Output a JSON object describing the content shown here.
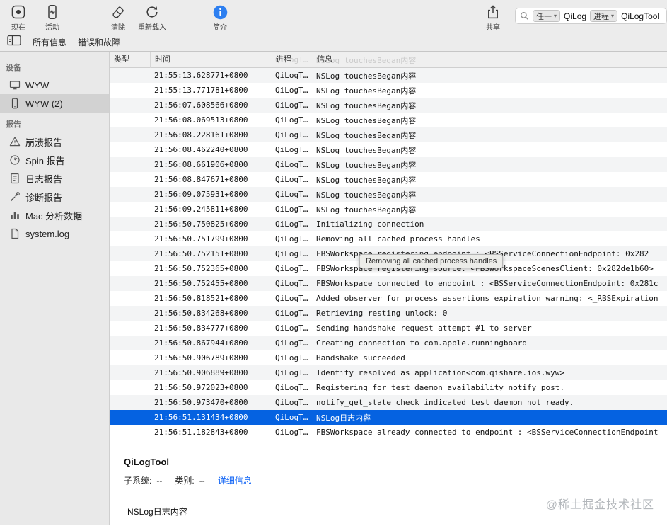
{
  "toolbar": {
    "now_label": "现在",
    "activity_label": "活动",
    "clear_label": "清除",
    "reload_label": "重新载入",
    "info_label": "简介",
    "share_label": "共享",
    "search_tokens": [
      {
        "type": "任一",
        "value": "QiLog"
      },
      {
        "type": "进程",
        "value": "QiLogTool"
      }
    ]
  },
  "filter_bar": {
    "all_messages": "所有信息",
    "errors_faults": "错误和故障"
  },
  "sidebar": {
    "devices_title": "设备",
    "devices": [
      {
        "label": "WYW",
        "icon": "display",
        "selected": false
      },
      {
        "label": "WYW (2)",
        "icon": "iphone",
        "selected": true
      }
    ],
    "reports_title": "报告",
    "reports": [
      {
        "label": "崩溃报告",
        "icon": "warning"
      },
      {
        "label": "Spin 报告",
        "icon": "spin"
      },
      {
        "label": "日志报告",
        "icon": "logdoc"
      },
      {
        "label": "诊断报告",
        "icon": "wrench"
      },
      {
        "label": "Mac 分析数据",
        "icon": "chart"
      },
      {
        "label": "system.log",
        "icon": "doc"
      }
    ]
  },
  "table": {
    "columns": {
      "type": "类型",
      "time": "时间",
      "process": "进程",
      "message": "信息"
    },
    "rows": [
      {
        "time": "",
        "process": "QiLogT…",
        "message": "NSLog touchesBegan内容",
        "under_header": true
      },
      {
        "time": "21:55:13.628771+0800",
        "process": "QiLogT…",
        "message": "NSLog touchesBegan内容",
        "shaded": true
      },
      {
        "time": "21:55:13.771781+0800",
        "process": "QiLogT…",
        "message": "NSLog touchesBegan内容"
      },
      {
        "time": "21:56:07.608566+0800",
        "process": "QiLogT…",
        "message": "NSLog touchesBegan内容",
        "shaded": true
      },
      {
        "time": "21:56:08.069513+0800",
        "process": "QiLogT…",
        "message": "NSLog touchesBegan内容"
      },
      {
        "time": "21:56:08.228161+0800",
        "process": "QiLogT…",
        "message": "NSLog touchesBegan内容",
        "shaded": true
      },
      {
        "time": "21:56:08.462240+0800",
        "process": "QiLogT…",
        "message": "NSLog touchesBegan内容"
      },
      {
        "time": "21:56:08.661906+0800",
        "process": "QiLogT…",
        "message": "NSLog touchesBegan内容",
        "shaded": true
      },
      {
        "time": "21:56:08.847671+0800",
        "process": "QiLogT…",
        "message": "NSLog touchesBegan内容"
      },
      {
        "time": "21:56:09.075931+0800",
        "process": "QiLogT…",
        "message": "NSLog touchesBegan内容",
        "shaded": true
      },
      {
        "time": "21:56:09.245811+0800",
        "process": "QiLogT…",
        "message": "NSLog touchesBegan内容"
      },
      {
        "time": "21:56:50.750825+0800",
        "process": "QiLogT…",
        "message": "Initializing connection",
        "shaded": true
      },
      {
        "time": "21:56:50.751799+0800",
        "process": "QiLogT…",
        "message": "Removing all cached process handles"
      },
      {
        "time": "21:56:50.752151+0800",
        "process": "QiLogT…",
        "message": "FBSWorkspace registering endpoint : <BSServiceConnectionEndpoint: 0x282",
        "shaded": true
      },
      {
        "time": "21:56:50.752365+0800",
        "process": "QiLogT…",
        "message": "FBSWorkspace registering source: <FBSWorkspaceScenesClient: 0x282de1b60>"
      },
      {
        "time": "21:56:50.752455+0800",
        "process": "QiLogT…",
        "message": "FBSWorkspace connected to endpoint : <BSServiceConnectionEndpoint: 0x281c",
        "shaded": true
      },
      {
        "time": "21:56:50.818521+0800",
        "process": "QiLogT…",
        "message": "Added observer for process assertions expiration warning: <_RBSExpiration"
      },
      {
        "time": "21:56:50.834268+0800",
        "process": "QiLogT…",
        "message": "Retrieving resting unlock: 0",
        "shaded": true
      },
      {
        "time": "21:56:50.834777+0800",
        "process": "QiLogT…",
        "message": "Sending handshake request attempt #1 to server"
      },
      {
        "time": "21:56:50.867944+0800",
        "process": "QiLogT…",
        "message": "Creating connection to com.apple.runningboard",
        "shaded": true
      },
      {
        "time": "21:56:50.906789+0800",
        "process": "QiLogT…",
        "message": "Handshake succeeded"
      },
      {
        "time": "21:56:50.906889+0800",
        "process": "QiLogT…",
        "message": "Identity resolved as application<com.qishare.ios.wyw>",
        "shaded": true
      },
      {
        "time": "21:56:50.972023+0800",
        "process": "QiLogT…",
        "message": "Registering for test daemon availability notify post."
      },
      {
        "time": "21:56:50.973470+0800",
        "process": "QiLogT…",
        "message": "notify_get_state check indicated test daemon not ready.",
        "shaded": true
      },
      {
        "time": "21:56:51.131434+0800",
        "process": "QiLogT…",
        "message": "NSLog日志内容",
        "selected": true
      },
      {
        "time": "21:56:51.182843+0800",
        "process": "QiLogT…",
        "message": "FBSWorkspace already connected to endpoint : <BSServiceConnectionEndpoint"
      }
    ]
  },
  "tooltip": {
    "text": "Removing all cached process handles"
  },
  "detail": {
    "title": "QiLogTool",
    "subsystem_label": "子系统:",
    "subsystem_value": "--",
    "category_label": "类别:",
    "category_value": "--",
    "details_link": "详细信息",
    "message": "NSLog日志内容"
  },
  "watermark": "@稀土掘金技术社区"
}
